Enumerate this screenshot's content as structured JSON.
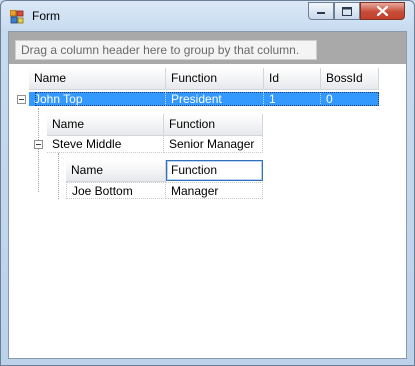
{
  "window": {
    "title": "Form",
    "controls": {
      "minimize": "minimize",
      "maximize": "maximize",
      "close": "close"
    }
  },
  "group_panel": {
    "text": "Drag a column header here to group by that column."
  },
  "master": {
    "columns": [
      "Name",
      "Function",
      "Id",
      "BossId"
    ],
    "row": {
      "name": "John Top",
      "function": "President",
      "id": "1",
      "boss_id": "0"
    }
  },
  "level2": {
    "columns": [
      "Name",
      "Function"
    ],
    "row": {
      "name": "Steve Middle",
      "function": "Senior Manager"
    }
  },
  "level3": {
    "columns": [
      "Name",
      "Function"
    ],
    "row": {
      "name": "Joe Bottom",
      "function": "Manager"
    }
  },
  "colors": {
    "selection": "#3399ff",
    "group_bar": "#a9a9a9",
    "close_button": "#c74c38"
  }
}
